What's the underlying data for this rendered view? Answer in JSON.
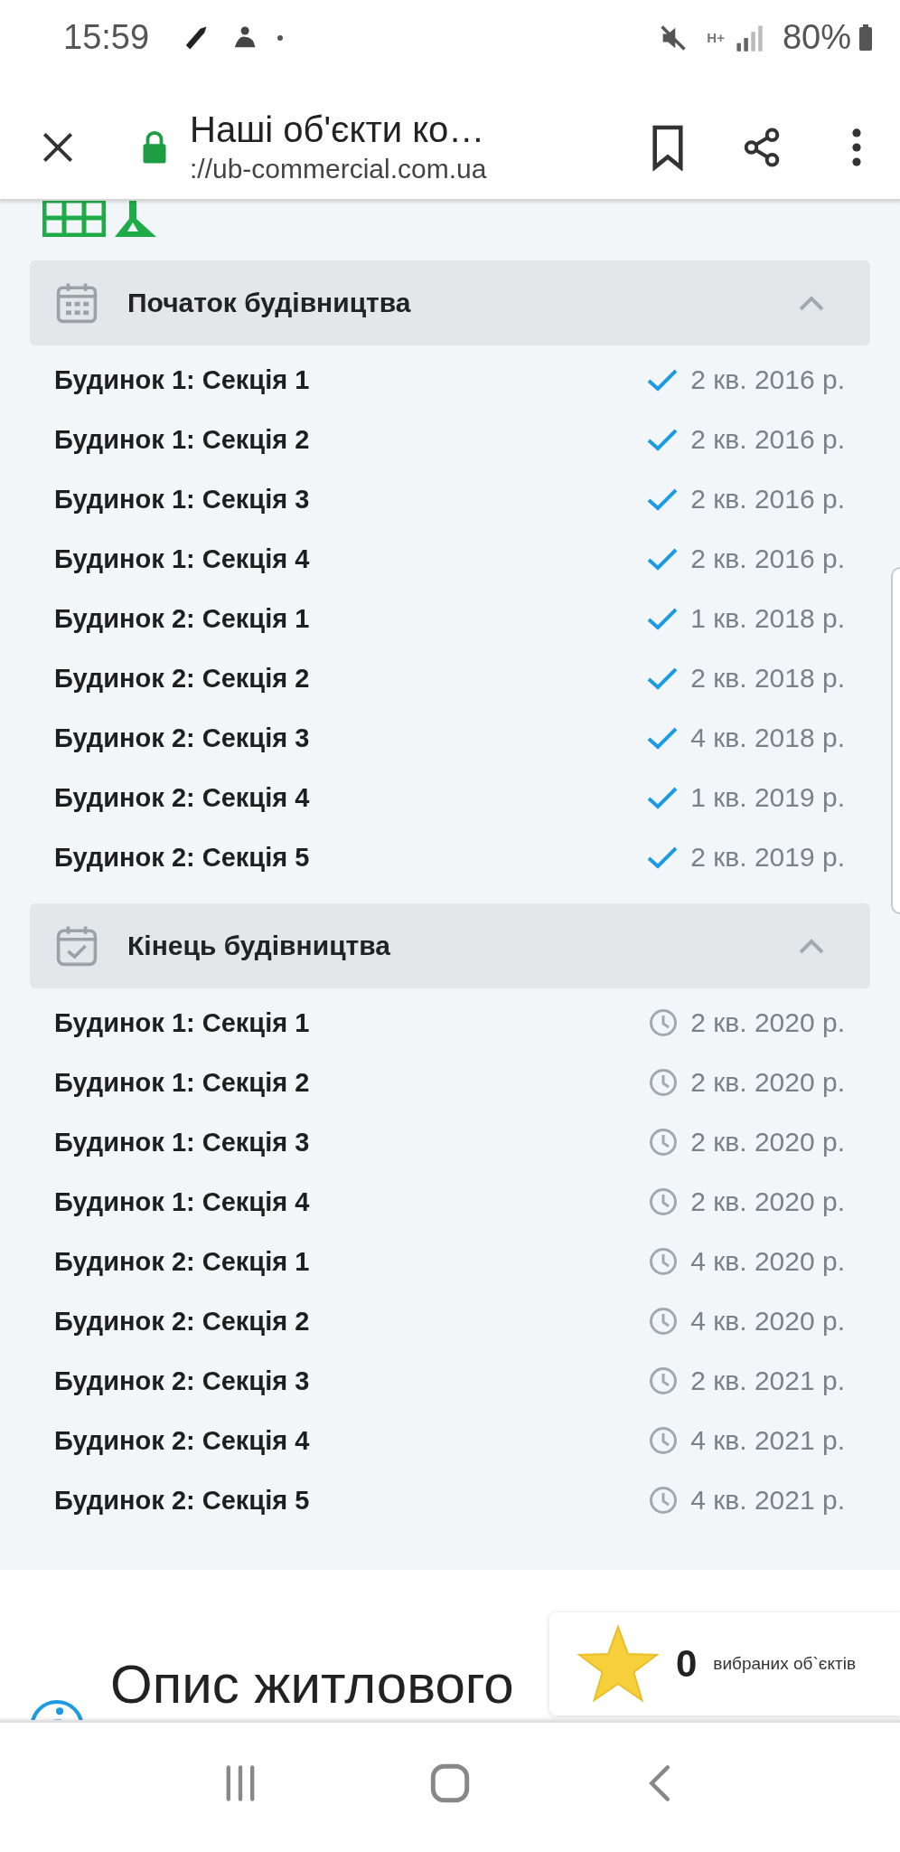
{
  "status_bar": {
    "time": "15:59",
    "network_type": "H+",
    "battery": "80%"
  },
  "browser_bar": {
    "title": "Наші об'єкти ко…",
    "url": "://ub-commercial.com.ua"
  },
  "sections": [
    {
      "title": "Початок будівництва",
      "kind": "start",
      "expanded": true,
      "rows": [
        {
          "name": "Будинок 1: Секція 1",
          "kind": "done",
          "date": "2 кв. 2016 р."
        },
        {
          "name": "Будинок 1: Секція 2",
          "kind": "done",
          "date": "2 кв. 2016 р."
        },
        {
          "name": "Будинок 1: Секція 3",
          "kind": "done",
          "date": "2 кв. 2016 р."
        },
        {
          "name": "Будинок 1: Секція 4",
          "kind": "done",
          "date": "2 кв. 2016 р."
        },
        {
          "name": "Будинок 2: Секція 1",
          "kind": "done",
          "date": "1 кв. 2018 р."
        },
        {
          "name": "Будинок 2: Секція 2",
          "kind": "done",
          "date": "2 кв. 2018 р."
        },
        {
          "name": "Будинок 2: Секція 3",
          "kind": "done",
          "date": "4 кв. 2018 р."
        },
        {
          "name": "Будинок 2: Секція 4",
          "kind": "done",
          "date": "1 кв. 2019 р."
        },
        {
          "name": "Будинок 2: Секція 5",
          "kind": "done",
          "date": "2 кв. 2019 р."
        }
      ]
    },
    {
      "title": "Кінець будівництва",
      "kind": "end",
      "expanded": true,
      "rows": [
        {
          "name": "Будинок 1: Секція 1",
          "kind": "planned",
          "date": "2 кв. 2020 р."
        },
        {
          "name": "Будинок 1: Секція 2",
          "kind": "planned",
          "date": "2 кв. 2020 р."
        },
        {
          "name": "Будинок 1: Секція 3",
          "kind": "planned",
          "date": "2 кв. 2020 р."
        },
        {
          "name": "Будинок 1: Секція 4",
          "kind": "planned",
          "date": "2 кв. 2020 р."
        },
        {
          "name": "Будинок 2: Секція 1",
          "kind": "planned",
          "date": "4 кв. 2020 р."
        },
        {
          "name": "Будинок 2: Секція 2",
          "kind": "planned",
          "date": "4 кв. 2020 р."
        },
        {
          "name": "Будинок 2: Секція 3",
          "kind": "planned",
          "date": "2 кв. 2021 р."
        },
        {
          "name": "Будинок 2: Секція 4",
          "kind": "planned",
          "date": "4 кв. 2021 р."
        },
        {
          "name": "Будинок 2: Секція 5",
          "kind": "planned",
          "date": "4 кв. 2021 р."
        }
      ]
    }
  ],
  "description": {
    "title": "Опис житлового"
  },
  "favorites": {
    "count": "0",
    "label": "вибраних об`єктів"
  }
}
